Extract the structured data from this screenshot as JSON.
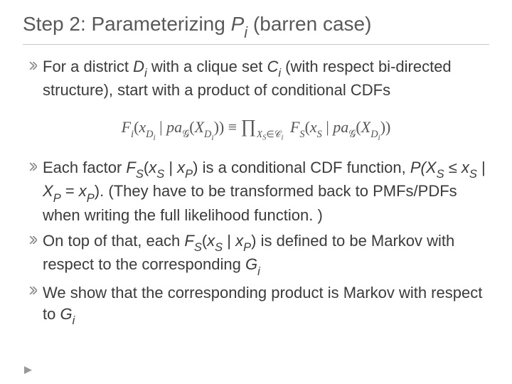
{
  "title": {
    "prefix": "Step 2: Parameterizing ",
    "pvar_base": "P",
    "pvar_sub": "i",
    "suffix": " (barren case)"
  },
  "bullets": {
    "b1": {
      "t1": "For a district ",
      "d_base": "D",
      "d_sub": "i",
      "t2": " with a clique set ",
      "c_base": "C",
      "c_sub": "i",
      "t3": " (with respect bi-directed structure), start with a product of conditional CDFs"
    },
    "b2": {
      "t1": "Each factor ",
      "f_base": "F",
      "f_sub": "S",
      "paren_open": "(",
      "xs_base": "x",
      "xs_sub": "S",
      "bar": " | ",
      "xp_base": "x",
      "xp_sub": "P",
      "paren_close": ")",
      "t2": " is a conditional CDF function, ",
      "prob_open": "P(",
      "Xs_base": "X",
      "Xs_sub": "S",
      "le": " ≤ ",
      "xs2_base": "x",
      "xs2_sub": "S",
      "bar2": " | ",
      "Xp_base": "X",
      "Xp_sub": "P",
      "eq": " = ",
      "xp2_base": "x",
      "xp2_sub": "P",
      "prob_close": ").",
      "t3": " (They have to be transformed back to PMFs/PDFs when writing the full likelihood function. )"
    },
    "b3": {
      "t1": "On top of that, each ",
      "f_base": "F",
      "f_sub": "S",
      "paren_open": "(",
      "xs_base": "x",
      "xs_sub": "S",
      "bar": " | ",
      "xp_base": "x",
      "xp_sub": "P",
      "paren_close": ")",
      "t2": " is defined to be Markov with respect to the corresponding ",
      "g_base": "G",
      "g_sub": "i"
    },
    "b4": {
      "t1": "We show that the corresponding product is Markov with respect to ",
      "g_base": "G",
      "g_sub": "i"
    }
  },
  "formula": {
    "lhs_F": "F",
    "lhs_i": "i",
    "lhs_open": "(",
    "lhs_x": "x",
    "lhs_Di": "D",
    "lhs_Di_i": "i",
    "lhs_bar": " | ",
    "lhs_pag": "pa",
    "lhs_g": "𝒢",
    "lhs_paX_open": "(",
    "lhs_X": "X",
    "lhs_XDi": "D",
    "lhs_XDi_i": "i",
    "lhs_paX_close": "))",
    "equiv": "   ≡   ",
    "prod": "∏",
    "prod_sub_X": "X",
    "prod_sub_S": "S",
    "prod_sub_in": "∈",
    "prod_sub_C": "𝒞",
    "prod_sub_i": "i",
    "rhs_F": "F",
    "rhs_S": "S",
    "rhs_open": "(",
    "rhs_x": "x",
    "rhs_xS": "S",
    "rhs_bar": " | ",
    "rhs_pag": "pa",
    "rhs_g": "𝒢",
    "rhs_paX_open": "(",
    "rhs_X": "X",
    "rhs_XDi": "D",
    "rhs_XDi_i": "i",
    "rhs_paX_close": "))"
  }
}
